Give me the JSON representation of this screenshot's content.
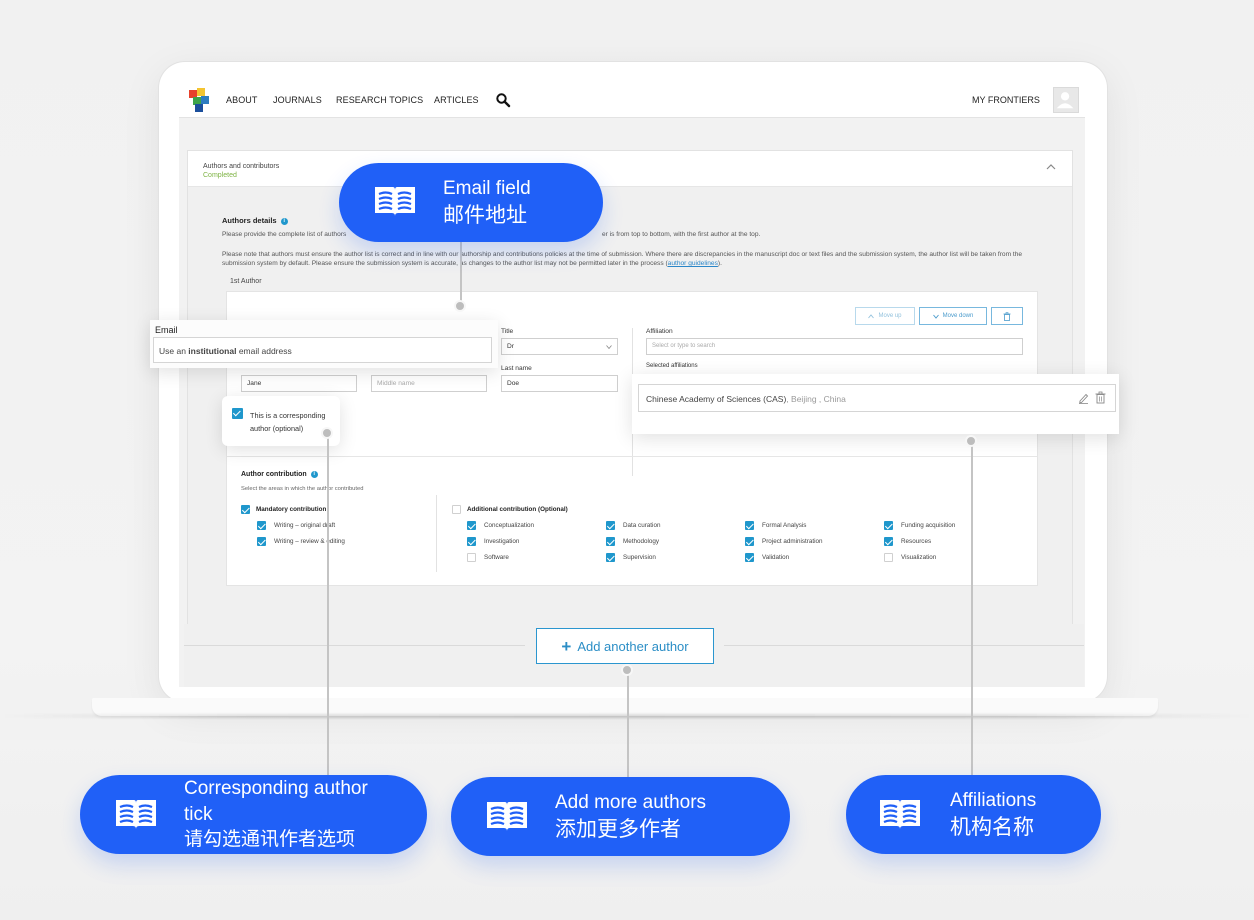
{
  "nav": {
    "items": [
      "ABOUT",
      "JOURNALS",
      "RESEARCH TOPICS",
      "ARTICLES"
    ],
    "my_frontiers": "MY FRONTIERS"
  },
  "section": {
    "title": "Authors and contributors",
    "status": "Completed",
    "authors_details_heading": "Authors details",
    "para1_a": "Please provide the complete list of authors",
    "para1_b": "er is from top to bottom, with the first author at the top.",
    "para2": "Please note that authors must ensure the author list is correct and in line with our authorship and contributions policies at the time of submission. Where there are discrepancies in the manuscript doc or text files and the submission system, the author list will be taken from the submission system by default. Please ensure the submission system is accurate, as changes to the author list may not be permitted later in the process (",
    "para2_link": "author guidelines",
    "para2_end": ").",
    "author_label": "1st Author"
  },
  "author_form": {
    "move_up": "Move up",
    "move_down": "Move down",
    "email_label": "Email",
    "email_placeholder_pre": "Use an ",
    "email_placeholder_bold": "institutional",
    "email_placeholder_post": " email address",
    "title_label": "Title",
    "title_value": "Dr",
    "first_name_value": "Jane",
    "middle_name_placeholder": "Middle name",
    "last_name_label": "Last name",
    "last_name_value": "Doe",
    "corresponding_text_1": "This is a corresponding",
    "corresponding_text_2": "author (optional)",
    "affiliation_label": "Affiliation",
    "affiliation_placeholder": "Select or type to search",
    "selected_affiliations_label": "Selected affiliations",
    "selected_affiliation": "Chinese Academy of Sciences (CAS)",
    "selected_affiliation_location": ", Beijing , China"
  },
  "contribution": {
    "heading": "Author contribution",
    "subtitle": "Select the areas in which the author contributed",
    "mandatory_label": "Mandatory contribution",
    "mandatory_items": [
      "Writing – original draft",
      "Writing – review & editing"
    ],
    "additional_label": "Additional contribution (Optional)",
    "additional_items": [
      {
        "label": "Conceptualization",
        "checked": true
      },
      {
        "label": "Data curation",
        "checked": true
      },
      {
        "label": "Formal Analysis",
        "checked": true
      },
      {
        "label": "Funding acquisition",
        "checked": true
      },
      {
        "label": "Investigation",
        "checked": true
      },
      {
        "label": "Methodology",
        "checked": true
      },
      {
        "label": "Project administration",
        "checked": true
      },
      {
        "label": "Resources",
        "checked": true
      },
      {
        "label": "Software",
        "checked": false
      },
      {
        "label": "Supervision",
        "checked": true
      },
      {
        "label": "Validation",
        "checked": true
      },
      {
        "label": "Visualization",
        "checked": false
      }
    ]
  },
  "add_author_button": "Add another author",
  "callouts": {
    "email": {
      "en": "Email field",
      "zh": "邮件地址"
    },
    "corresponding": {
      "en_1": "Corresponding author",
      "en_2": "tick",
      "zh": "请勾选通讯作者选项"
    },
    "add_more": {
      "en": "Add more authors",
      "zh": "添加更多作者"
    },
    "affiliations": {
      "en": "Affiliations",
      "zh": "机构名称"
    }
  },
  "colors": {
    "accent_blue": "#2060f7",
    "checkbox_blue": "#1f97cc",
    "completed_green": "#7db343",
    "button_border": "#78b8de"
  },
  "icons": [
    "logo-icon",
    "search-icon",
    "user-avatar-icon",
    "chevron-up-icon",
    "chevron-down-icon",
    "trash-icon",
    "edit-icon",
    "info-icon",
    "book-icon",
    "plus-icon"
  ]
}
